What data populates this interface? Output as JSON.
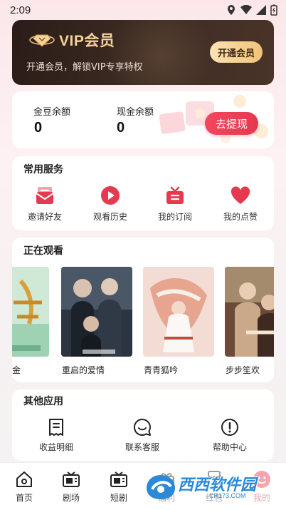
{
  "status_bar": {
    "time": "2:09"
  },
  "vip": {
    "title": "VIP会员",
    "description": "开通会员，解锁VIP专享特权",
    "button_label": "开通会员",
    "accent_color": "#f6d29a"
  },
  "balance": {
    "gold_label": "金豆余额",
    "gold_value": "0",
    "cash_label": "现金余额",
    "cash_value": "0",
    "withdraw_label": "去提现",
    "button_color": "#e6384f"
  },
  "services": {
    "title": "常用服务",
    "items": [
      {
        "label": "邀请好友",
        "icon": "envelope-icon"
      },
      {
        "label": "观看历史",
        "icon": "play-icon"
      },
      {
        "label": "我的订阅",
        "icon": "subscription-icon"
      },
      {
        "label": "我的点赞",
        "icon": "heart-icon"
      }
    ]
  },
  "watching": {
    "title": "正在观看",
    "items": [
      {
        "title": "金"
      },
      {
        "title": "重启的爱情"
      },
      {
        "title": "青青狐吟"
      },
      {
        "title": "步步笙欢"
      }
    ]
  },
  "other_apps": {
    "title": "其他应用",
    "items": [
      {
        "label": "收益明细",
        "icon": "receipt-icon"
      },
      {
        "label": "联系客服",
        "icon": "chat-icon"
      },
      {
        "label": "帮助中心",
        "icon": "help-icon"
      }
    ]
  },
  "tabs": [
    {
      "label": "首页",
      "icon": "home-icon"
    },
    {
      "label": "剧场",
      "icon": "tv-icon"
    },
    {
      "label": "短剧",
      "icon": "tv-icon"
    },
    {
      "label": "福利",
      "icon": "gift-icon"
    },
    {
      "label": "红包",
      "icon": "red-packet-icon"
    },
    {
      "label": "我的",
      "icon": "profile-icon",
      "active": true
    }
  ],
  "watermark": {
    "text": "西西软件园",
    "url": "CR173.COM"
  }
}
